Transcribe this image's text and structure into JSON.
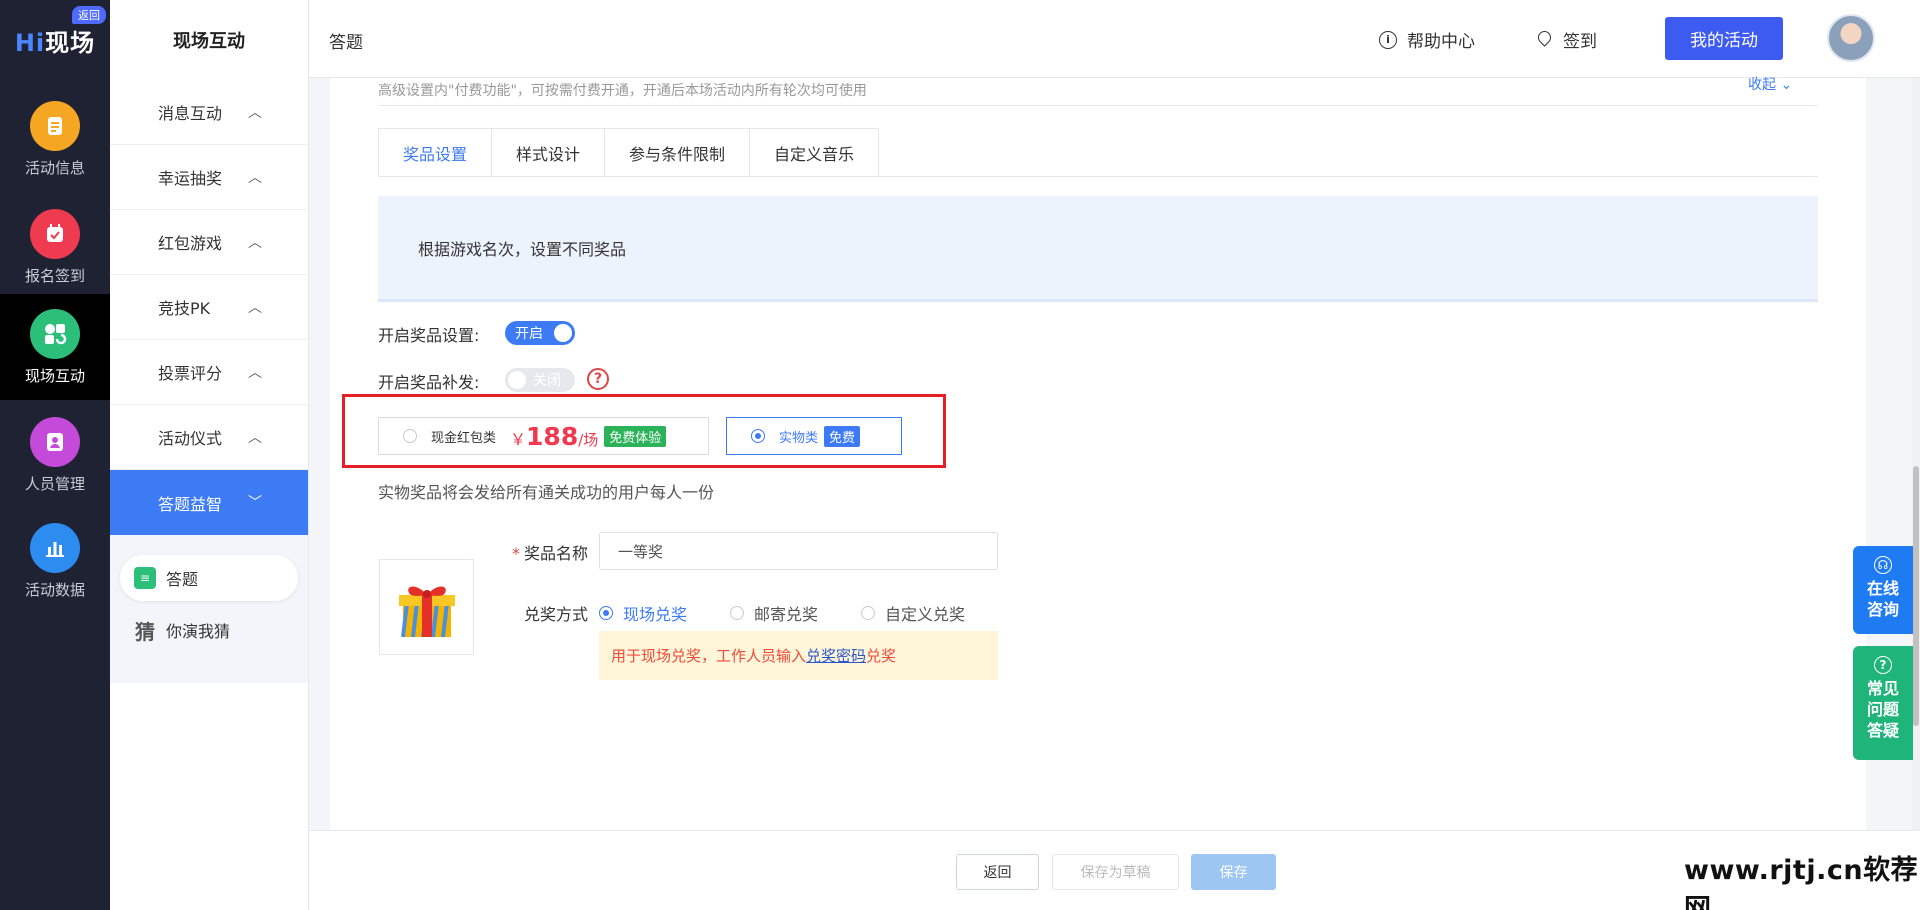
{
  "rail": {
    "logo_hi": "Hi",
    "logo_rest": "现场",
    "return_tag": "返回",
    "items": [
      {
        "label": "活动信息",
        "icon": "document-icon",
        "color": "#f5a623"
      },
      {
        "label": "报名签到",
        "icon": "calendar-check-icon",
        "color": "#ef3b4f"
      },
      {
        "label": "现场互动",
        "icon": "interaction-icon",
        "color": "#2bbf7a"
      },
      {
        "label": "人员管理",
        "icon": "person-icon",
        "color": "#c44ad9"
      },
      {
        "label": "活动数据",
        "icon": "bar-chart-icon",
        "color": "#2d8cf0"
      }
    ]
  },
  "menu": {
    "title": "现场互动",
    "items": [
      {
        "label": "消息互动"
      },
      {
        "label": "幸运抽奖"
      },
      {
        "label": "红包游戏"
      },
      {
        "label": "竞技PK"
      },
      {
        "label": "投票评分"
      },
      {
        "label": "活动仪式"
      },
      {
        "label": "答题益智"
      }
    ],
    "sub_items": [
      {
        "label": "答题",
        "icon": "quiz-icon"
      },
      {
        "label": "你演我猜",
        "icon_text": "猜"
      }
    ]
  },
  "header": {
    "crumb": "答题",
    "help": "帮助中心",
    "signin": "签到",
    "my_activity": "我的活动"
  },
  "content": {
    "hint_top": "高级设置内\"付费功能\"，可按需付费开通，开通后本场活动内所有轮次均可使用",
    "collapse": "收起 ⌄",
    "tabs": [
      "奖品设置",
      "样式设计",
      "参与条件限制",
      "自定义音乐"
    ],
    "info": "根据游戏名次，设置不同奖品",
    "prize_switch_label": "开启奖品设置:",
    "prize_switch_state": "开启",
    "reissue_label": "开启奖品补发:",
    "reissue_state": "关闭",
    "option_cash": {
      "label": "现金红包类",
      "yen": "￥",
      "price": "188",
      "unit": "/场",
      "badge": "免费体验"
    },
    "option_physical": {
      "label": "实物类",
      "badge": "免费"
    },
    "desc": "实物奖品将会发给所有通关成功的用户每人一份",
    "prize_name_label": "奖品名称",
    "prize_name_required": "*",
    "prize_name_value": "一等奖",
    "redeem_label": "兑奖方式",
    "redeem_options": [
      "现场兑奖",
      "邮寄兑奖",
      "自定义兑奖"
    ],
    "tip_prefix": "用于现场兑奖，工作人员输入",
    "tip_link": "兑奖密码",
    "tip_suffix": "兑奖"
  },
  "footer": {
    "back": "返回",
    "draft": "保存为草稿",
    "save": "保存",
    "watermark": "www.rjtj.cn软荐网"
  },
  "floats": {
    "consult": "在线咨询",
    "consult_l1": "在线",
    "consult_l2": "咨询",
    "faq_l1": "常见",
    "faq_l2": "问题",
    "faq_l3": "答疑"
  }
}
